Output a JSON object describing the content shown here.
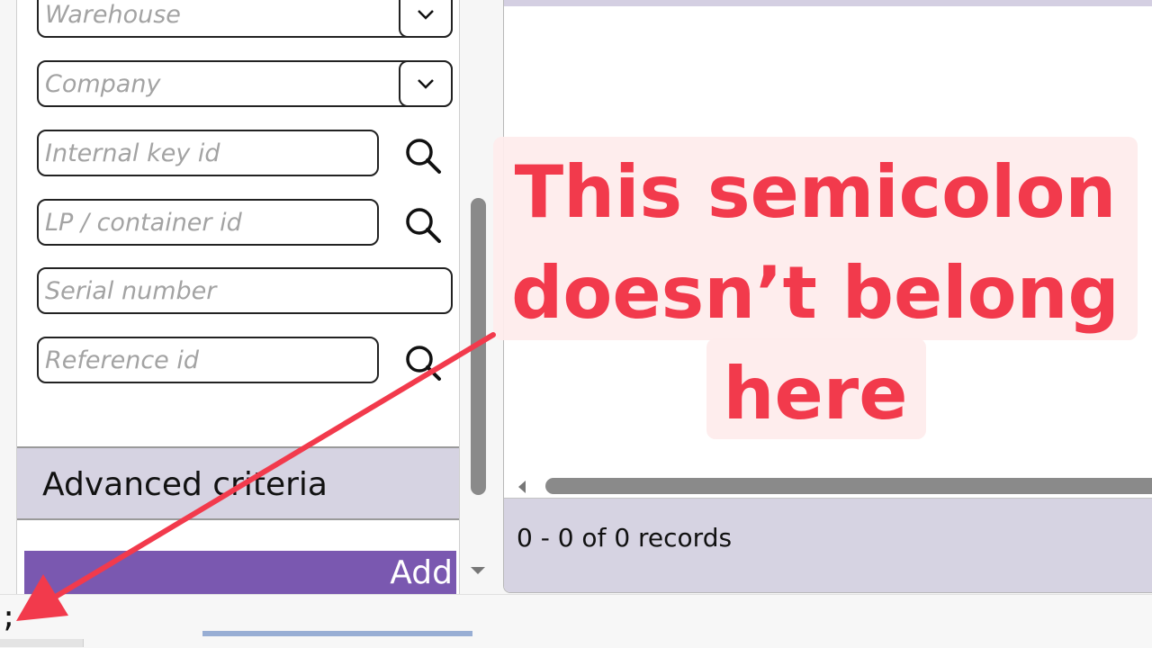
{
  "filters": {
    "warehouse_placeholder": "Warehouse",
    "company_placeholder": "Company",
    "internal_key_placeholder": "Internal key id",
    "lp_container_placeholder": "LP / container id",
    "serial_number_placeholder": "Serial number",
    "reference_id_placeholder": "Reference id"
  },
  "advanced_criteria": {
    "label": "Advanced criteria"
  },
  "add_button": {
    "label": "Add"
  },
  "results": {
    "records_count": "0 - 0 of 0 records"
  },
  "editor": {
    "stray_text": ";"
  },
  "annotation": {
    "line1": "This semicolon",
    "line2": "doesn’t belong",
    "line3": "here",
    "color": "#f23a4c"
  },
  "icons": {
    "dropdown": "chevron-down-icon",
    "search": "search-icon",
    "arrow": "annotation-arrow"
  },
  "colors": {
    "accent_purple": "#7a58b0",
    "panel_lavender": "#d6d3e2",
    "callout_bg": "#feebeb"
  }
}
